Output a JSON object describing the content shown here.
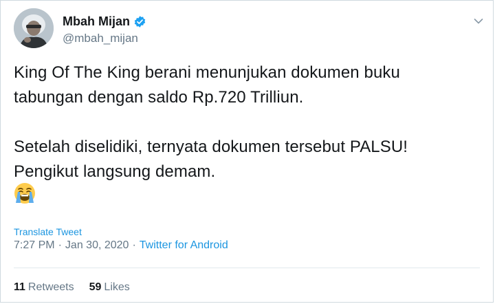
{
  "tweet": {
    "display_name": "Mbah Mijan",
    "handle": "@mbah_mijan",
    "text_lines": [
      "King Of The King berani menunjukan dokumen buku",
      "tabungan dengan saldo Rp.720 Trilliun.",
      "Setelah diselidiki, ternyata dokumen tersebut PALSU!",
      "Pengikut langsung demam."
    ],
    "translate_label": "Translate Tweet",
    "time": "7:27 PM",
    "date": "Jan 30, 2020",
    "separator": "·",
    "source": "Twitter for Android",
    "stats": {
      "retweets_count": "11",
      "retweets_label": "Retweets",
      "likes_count": "59",
      "likes_label": "Likes"
    }
  },
  "colors": {
    "link": "#1b95e0",
    "text": "#14171a",
    "muted": "#657786",
    "verified": "#1da1f2"
  },
  "icons": {
    "verified": "verified-badge-icon",
    "more": "chevron-down-icon",
    "emoji": "loudly-crying-face-emoji"
  }
}
